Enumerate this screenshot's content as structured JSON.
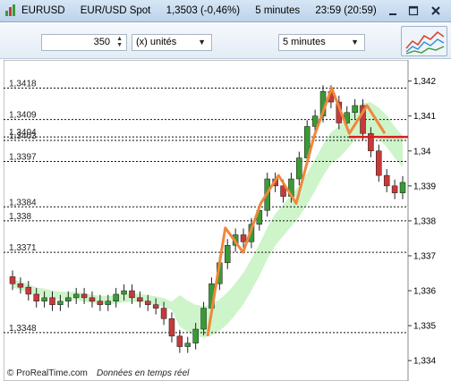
{
  "window": {
    "symbol": "EURUSD",
    "instrument": "EUR/USD Spot",
    "price_change": "1,3503 (-0,46%)",
    "timeframe": "5 minutes",
    "time_range": "23:59 (20:59)",
    "colors": {
      "titlebar": "#c8dbee",
      "accent": "#1d3c6e"
    }
  },
  "toolbar": {
    "quantity": "350",
    "units": "(x) unités",
    "period": "5 minutes"
  },
  "chart": {
    "price_levels": [
      "1,3418",
      "1,3409",
      "1,3404",
      "1,3403",
      "1,3397",
      "1,3384",
      "1,338",
      "1,3371",
      "1,3348"
    ],
    "axis_ticks": [
      "1,342",
      "1,341",
      "1,34",
      "1,339",
      "1,338",
      "1,337",
      "1,336",
      "1,335",
      "1,334"
    ],
    "footer_brand": "© ProRealTime.com",
    "footer_note": "Données en temps réel"
  },
  "chart_data": {
    "type": "candlestick",
    "y_axis_ticks": [
      1.342,
      1.341,
      1.34,
      1.339,
      1.338,
      1.337,
      1.336,
      1.335,
      1.334
    ],
    "ylim": [
      1.3338,
      1.3424
    ],
    "horizontal_levels": [
      1.3418,
      1.3409,
      1.3404,
      1.3403,
      1.3397,
      1.3384,
      1.338,
      1.3371,
      1.3348
    ],
    "close_series": [
      1.3362,
      1.3361,
      1.3359,
      1.3357,
      1.3358,
      1.3356,
      1.3357,
      1.3358,
      1.3359,
      1.3358,
      1.3357,
      1.3356,
      1.3357,
      1.3359,
      1.336,
      1.3358,
      1.3357,
      1.3356,
      1.3355,
      1.3352,
      1.3347,
      1.3344,
      1.3345,
      1.3349,
      1.3355,
      1.3362,
      1.3368,
      1.3373,
      1.3376,
      1.3374,
      1.3379,
      1.3383,
      1.3392,
      1.339,
      1.3387,
      1.3392,
      1.3398,
      1.3407,
      1.341,
      1.3417,
      1.3414,
      1.3408,
      1.3411,
      1.3413,
      1.3405,
      1.34,
      1.3393,
      1.339,
      1.3388,
      1.3391
    ],
    "overlay_line": [
      1.3347,
      1.3378,
      1.3371,
      1.3385,
      1.3393,
      1.3385,
      1.3404,
      1.3418,
      1.3405,
      1.3413,
      1.3405
    ],
    "resistance_level": 1.3404,
    "colors": {
      "up": "#3a9a35",
      "down": "#c63a3a",
      "overlay": "#f0873c",
      "resistance": "#d81e1e",
      "band": "#bdf0b8"
    }
  }
}
